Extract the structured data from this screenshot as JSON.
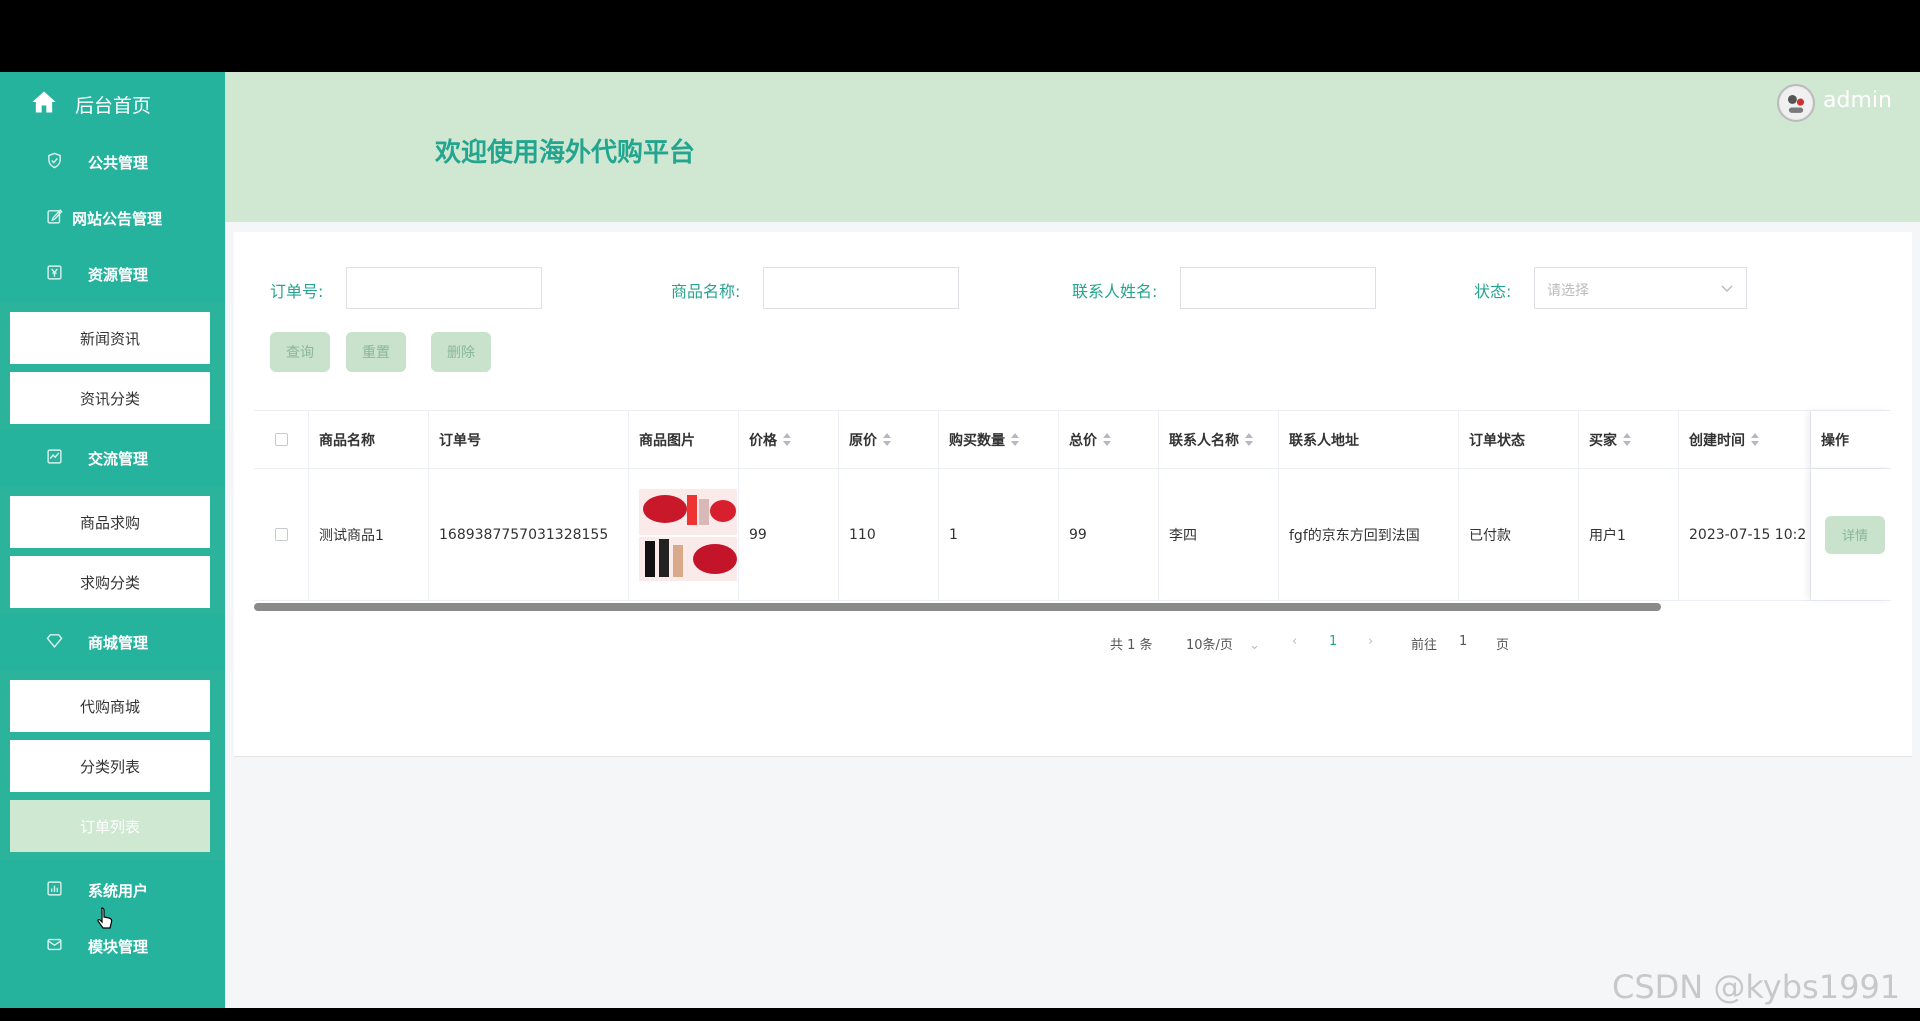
{
  "sidebar": {
    "home_label": "后台首页",
    "groups": [
      {
        "label": "公共管理",
        "icon": "shield-icon"
      },
      {
        "label": "网站公告管理",
        "icon": "edit-icon"
      },
      {
        "label": "资源管理",
        "icon": "yen-icon",
        "items": [
          "新闻资讯",
          "资讯分类"
        ]
      },
      {
        "label": "交流管理",
        "icon": "chart-line-icon",
        "items": [
          "商品求购",
          "求购分类"
        ]
      },
      {
        "label": "商城管理",
        "icon": "diamond-icon",
        "items": [
          "代购商城",
          "分类列表",
          "订单列表"
        ]
      },
      {
        "label": "系统用户",
        "icon": "bar-chart-icon"
      },
      {
        "label": "模块管理",
        "icon": "mail-icon"
      }
    ],
    "active_item": "订单列表"
  },
  "header": {
    "title": "欢迎使用海外代购平台",
    "username": "admin"
  },
  "filters": {
    "order_no_label": "订单号:",
    "product_name_label": "商品名称:",
    "contact_name_label": "联系人姓名:",
    "status_label": "状态:",
    "status_placeholder": "请选择"
  },
  "buttons": {
    "query": "查询",
    "reset": "重置",
    "delete": "删除"
  },
  "table": {
    "columns": [
      "商品名称",
      "订单号",
      "商品图片",
      "价格",
      "原价",
      "购买数量",
      "总价",
      "联系人名称",
      "联系人地址",
      "订单状态",
      "买家",
      "创建时间",
      "操作"
    ],
    "rows": [
      {
        "product_name": "测试商品1",
        "order_no": "1689387757031328155",
        "price": "99",
        "original_price": "110",
        "quantity": "1",
        "total": "99",
        "contact_name": "李四",
        "contact_address": "fgf的京东方回到法国",
        "status": "已付款",
        "buyer": "用户1",
        "created_at": "2023-07-15 10:2",
        "action": "详情"
      }
    ]
  },
  "pagination": {
    "total_text": "共 1 条",
    "page_size": "10条/页",
    "current_page": "1",
    "goto_label": "前往",
    "goto_value": "1",
    "page_suffix": "页"
  },
  "watermark": "CSDN @kybs1991",
  "colors": {
    "sidebar": "#26b39d",
    "header": "#d0e8d2",
    "accent_text": "#23a58f",
    "button": "#c8e2cc"
  }
}
